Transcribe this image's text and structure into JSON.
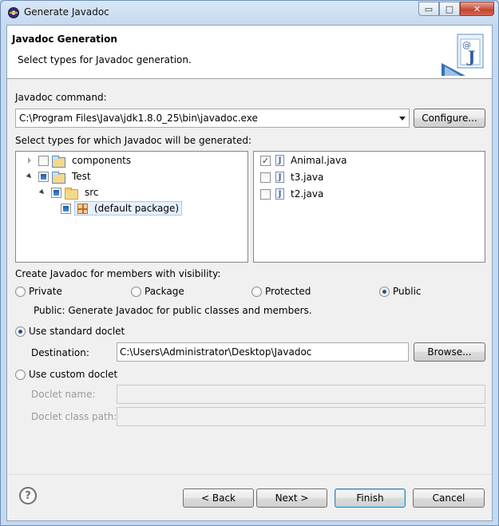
{
  "window": {
    "title": "Generate Javadoc",
    "minimize_glyph": "▭",
    "maximize_glyph": "□",
    "close_glyph": "✕"
  },
  "header": {
    "title": "Javadoc Generation",
    "description": "Select types for Javadoc generation.",
    "icon": "javadoc-wizard-icon"
  },
  "command": {
    "label": "Javadoc command:",
    "value": "C:\\Program Files\\Java\\jdk1.8.0_25\\bin\\javadoc.exe",
    "configure_label": "Configure..."
  },
  "types": {
    "label": "Select types for which Javadoc will be generated:",
    "tree": [
      {
        "label": "components",
        "state": "unchecked",
        "expanded": false
      },
      {
        "label": "Test",
        "state": "partial",
        "expanded": true
      },
      {
        "label": "src",
        "state": "partial",
        "expanded": true
      },
      {
        "label": "(default package)",
        "state": "partial",
        "selected": true
      }
    ],
    "files": [
      {
        "label": "Animal.java",
        "checked": true
      },
      {
        "label": "t3.java",
        "checked": false
      },
      {
        "label": "t2.java",
        "checked": false
      }
    ]
  },
  "visibility": {
    "label": "Create Javadoc for members with visibility:",
    "options": [
      "Private",
      "Package",
      "Protected",
      "Public"
    ],
    "selected": "Public",
    "description": "Public: Generate Javadoc for public classes and members."
  },
  "standard_doclet": {
    "label": "Use standard doclet",
    "selected": true,
    "destination_label": "Destination:",
    "destination_value": "C:\\Users\\Administrator\\Desktop\\Javadoc",
    "browse_label": "Browse..."
  },
  "custom_doclet": {
    "label": "Use custom doclet",
    "selected": false,
    "name_label": "Doclet name:",
    "name_value": "",
    "classpath_label": "Doclet class path:",
    "classpath_value": ""
  },
  "footer": {
    "help_glyph": "?",
    "back_label": "< Back",
    "next_label": "Next >",
    "finish_label": "Finish",
    "cancel_label": "Cancel"
  },
  "colors": {
    "accent": "#3c7fb1",
    "window_frame": "#b9d1ea",
    "dialog_bg": "#f0f0f0"
  }
}
